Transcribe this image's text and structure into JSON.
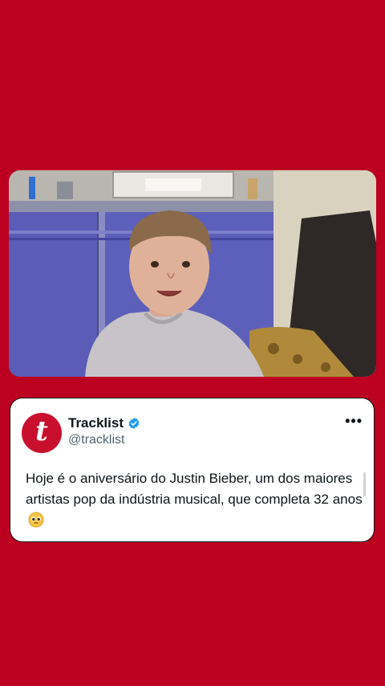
{
  "post": {
    "author_name": "Tracklist",
    "author_handle": "@tracklist",
    "avatar_letter": "t",
    "text": "Hoje é o aniversário do Justin Bieber, um dos maiores artistas pop da indústria musical, que completa 32 anos",
    "emoji": "pleading-face-with-tear",
    "more_icon": "•••"
  },
  "colors": {
    "background": "#bb0020",
    "avatar": "#c8102e",
    "verified": "#1d9bf0"
  },
  "video": {
    "description_icon": "video-frame-child"
  }
}
